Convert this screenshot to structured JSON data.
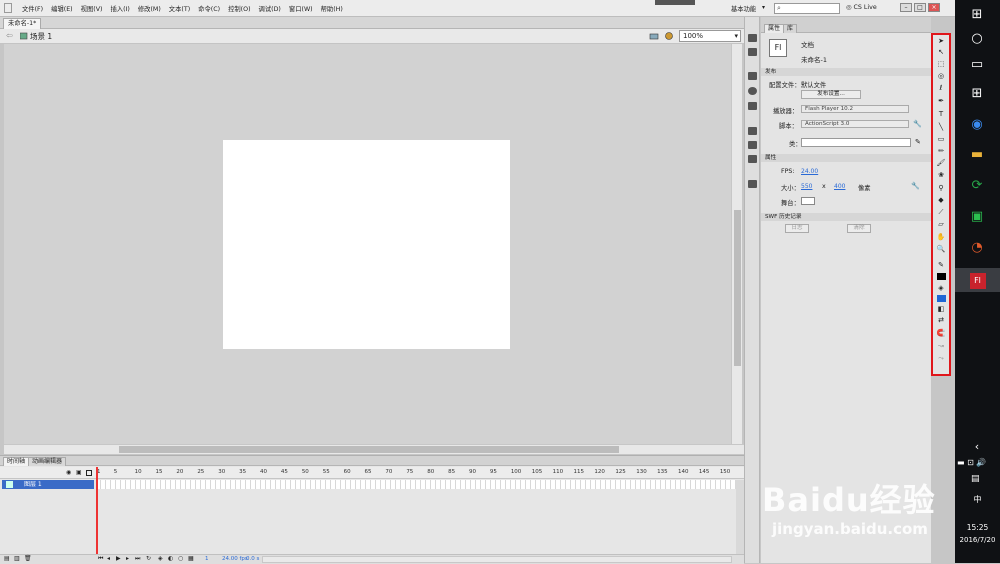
{
  "menubar": {
    "menus": [
      "文件(F)",
      "编辑(E)",
      "视图(V)",
      "插入(I)",
      "修改(M)",
      "文本(T)",
      "命令(C)",
      "控制(O)",
      "调试(D)",
      "窗口(W)",
      "帮助(H)"
    ],
    "workspace": "基本功能",
    "search_placeholder": "",
    "cs_live": "CS Live"
  },
  "document": {
    "tab_label": "未命名-1*",
    "scene_label": "场景 1",
    "zoom": "100%"
  },
  "timeline": {
    "tab_timeline": "时间轴",
    "tab_motion": "动画编辑器",
    "ticks": [
      "1",
      "5",
      "10",
      "15",
      "20",
      "25",
      "30",
      "35",
      "40",
      "45",
      "50",
      "55",
      "60",
      "65",
      "70",
      "75",
      "80",
      "85",
      "90",
      "95",
      "100",
      "105",
      "110",
      "115",
      "120",
      "125",
      "130",
      "135",
      "140",
      "145",
      "150"
    ],
    "layer_name": "图层 1",
    "current_frame": "1",
    "fps": "24.00 fps",
    "time": "0.0 s"
  },
  "properties": {
    "tab_props": "属性",
    "tab_library": "库",
    "doc_type": "文档",
    "doc_name": "未命名-1",
    "icon_text": "Fl",
    "publish_section": "发布",
    "profile_label": "配置文件：",
    "profile_value": "默认文件",
    "publish_settings_btn": "发布设置...",
    "player_label": "播放器：",
    "player_value": "Flash Player 10.2",
    "script_label": "脚本：",
    "script_value": "ActionScript 3.0",
    "class_label": "类：",
    "attributes_section": "属性",
    "fps_label": "FPS:",
    "fps_value": "24.00",
    "size_label": "大小：",
    "width": "550",
    "x_sep": "x",
    "height": "400",
    "unit": "像素",
    "stage_label": "舞台：",
    "swf_section": "SWF 历史记录",
    "log_btn": "日志",
    "clear_btn": "清除"
  },
  "taskbar": {
    "time": "15:25",
    "date": "2016/7/20",
    "ime": "中",
    "flash_label": "Fl"
  },
  "watermark": {
    "brand": "Baidu经验",
    "url": "jingyan.baidu.com"
  }
}
